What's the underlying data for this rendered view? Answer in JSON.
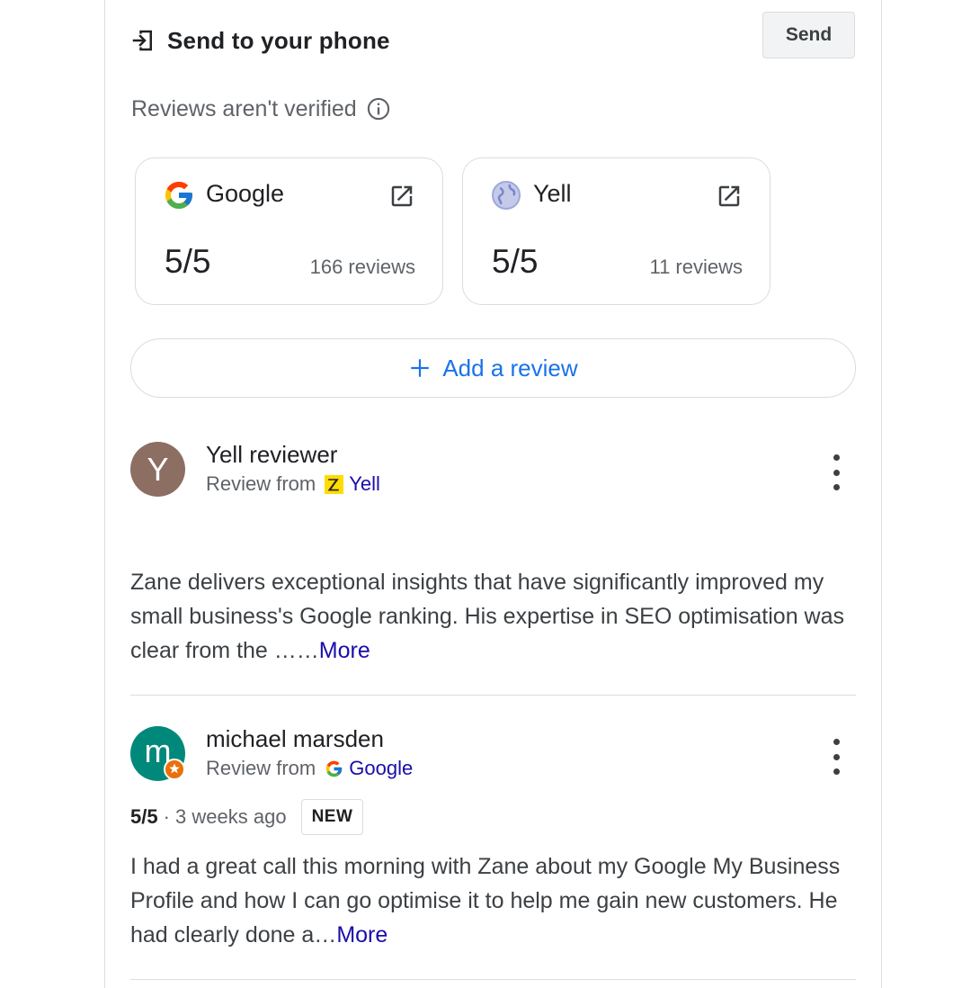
{
  "send": {
    "title": "Send to your phone",
    "button": "Send"
  },
  "verification": {
    "text": "Reviews aren't verified"
  },
  "sources": [
    {
      "name": "Google",
      "rating": "5/5",
      "count": "166 reviews"
    },
    {
      "name": "Yell",
      "rating": "5/5",
      "count": "11 reviews"
    }
  ],
  "add_review": {
    "label": "Add a review"
  },
  "reviews": [
    {
      "avatar_letter": "Y",
      "avatar_color": "#8d6e63",
      "name": "Yell reviewer",
      "from_prefix": "Review from",
      "source": "Yell",
      "text": "Zane delivers exceptional insights that have significantly improved my small business's Google ranking. His expertise in SEO optimisation was clear from the ……",
      "more": "More"
    },
    {
      "avatar_letter": "m",
      "avatar_color": "#00897b",
      "name": "michael marsden",
      "from_prefix": "Review from",
      "source": "Google",
      "rating": "5/5",
      "time": "· 3 weeks ago",
      "badge": "NEW",
      "text": "I had a great call this morning with Zane about my Google My Business Profile and how I can go optimise it to help me gain new customers. He had clearly done a…",
      "more": "More"
    }
  ],
  "colors": {
    "link": "#1a0dab",
    "accent_blue": "#1a73e8",
    "border": "#dadce0"
  }
}
